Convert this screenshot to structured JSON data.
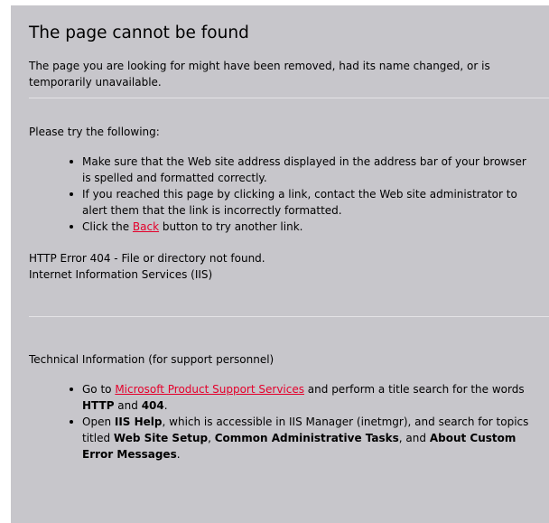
{
  "title": "The page cannot be found",
  "intro": "The page you are looking for might have been removed, had its name changed, or is temporarily unavailable.",
  "try_heading": "Please try the following:",
  "try_items": {
    "item1": "Make sure that the Web site address displayed in the address bar of your browser is spelled and formatted correctly.",
    "item2": "If you reached this page by clicking a link, contact the Web site administrator to alert them that the link is incorrectly formatted.",
    "item3_pre": "Click the ",
    "item3_link": "Back",
    "item3_post": " button to try another link."
  },
  "error_line1": "HTTP Error 404 - File or directory not found.",
  "error_line2": "Internet Information Services (IIS)",
  "tech_heading": "Technical Information (for support personnel)",
  "tech_items": {
    "item1_pre": "Go to ",
    "item1_link": "Microsoft Product Support Services",
    "item1_mid": " and perform a title search for the words ",
    "item1_b1": "HTTP",
    "item1_and": " and ",
    "item1_b2": "404",
    "item1_end": ".",
    "item2_pre": "Open ",
    "item2_b1": "IIS Help",
    "item2_mid": ", which is accessible in IIS Manager (inetmgr), and search for topics titled ",
    "item2_b2": "Web Site Setup",
    "item2_c1": ", ",
    "item2_b3": "Common Administrative Tasks",
    "item2_c2": ", and ",
    "item2_b4": "About Custom Error Messages",
    "item2_end": "."
  },
  "colors": {
    "background": "#c7c6cb",
    "link": "#e4002b",
    "rule": "#e4e3e6"
  }
}
